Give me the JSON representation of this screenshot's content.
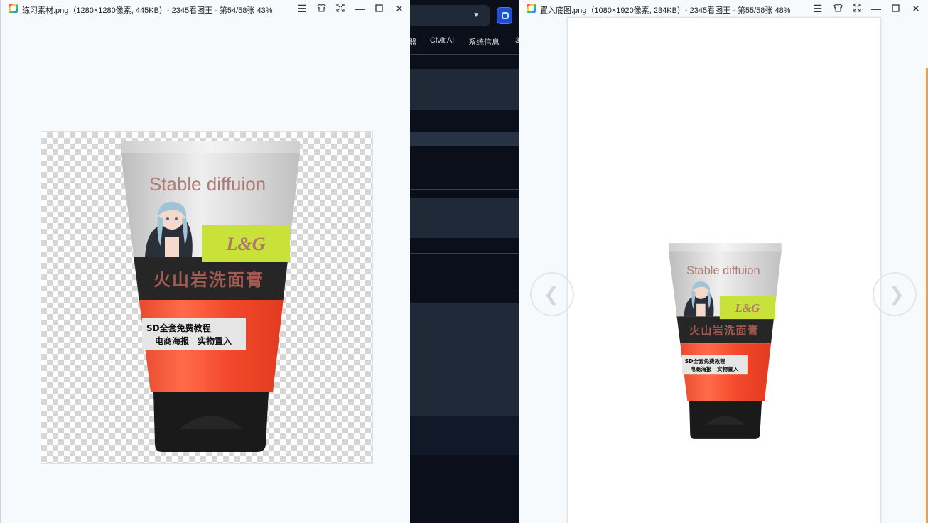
{
  "background_app": {
    "nav": [
      "器",
      "Civit AI",
      "系统信息",
      "3"
    ]
  },
  "left_window": {
    "title": "练习素材.png（1280×1280像素, 445KB）- 2345看图王 - 第54/58张 43%"
  },
  "right_window": {
    "title": "置入底图.png（1080×1920像素, 234KB）- 2345看图王 - 第55/58张 48%"
  },
  "product": {
    "brand": "Stable diffuion",
    "badge": "L&G",
    "name": "火山岩洗面膏",
    "sticker_line1": "SD全套免费教程",
    "sticker_line2": "电商海报　实物置入"
  },
  "icons": {
    "menu": "menu-icon",
    "skin": "shirt-icon",
    "fullscreen": "fullscreen-icon",
    "minimize": "minimize-icon",
    "maximize": "maximize-icon",
    "close": "close-icon",
    "prev": "chevron-left-icon",
    "next": "chevron-right-icon"
  },
  "colors": {
    "tube_top": "#d7d7d7",
    "tube_band": "#262626",
    "tube_orange": "#f04a2b",
    "badge": "#c9e23a",
    "cap": "#1a1a1a"
  }
}
